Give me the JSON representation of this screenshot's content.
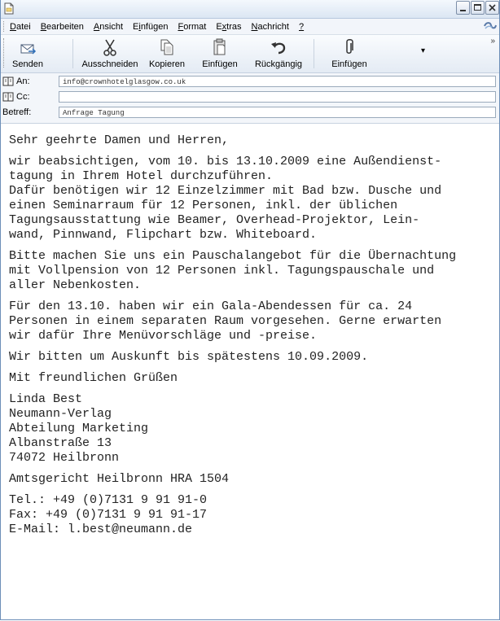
{
  "menu": {
    "items": [
      {
        "pre": "",
        "ul": "D",
        "post": "atei"
      },
      {
        "pre": "",
        "ul": "B",
        "post": "earbeiten"
      },
      {
        "pre": "",
        "ul": "A",
        "post": "nsicht"
      },
      {
        "pre": "E",
        "ul": "i",
        "post": "nfügen"
      },
      {
        "pre": "",
        "ul": "F",
        "post": "ormat"
      },
      {
        "pre": "E",
        "ul": "x",
        "post": "tras"
      },
      {
        "pre": "",
        "ul": "N",
        "post": "achricht"
      },
      {
        "pre": "",
        "ul": "?",
        "post": ""
      }
    ]
  },
  "toolbar": {
    "send": "Senden",
    "cut": "Ausschneiden",
    "copy": "Kopieren",
    "paste": "Einfügen",
    "undo": "Rückgängig",
    "attach": "Einfügen",
    "overflow": "»",
    "more": "▾"
  },
  "headers": {
    "to_label": "An:",
    "to_value": "info@crownhotelglasgow.co.uk",
    "cc_label": "Cc:",
    "cc_value": "",
    "subject_label": "Betreff:",
    "subject_value": "Anfrage Tagung"
  },
  "body": {
    "p1": "Sehr geehrte Damen und Herren,",
    "p2": "wir beabsichtigen, vom 10. bis 13.10.2009 eine Außendienst-\ntagung in Ihrem Hotel durchzuführen.\nDafür benötigen wir 12 Einzelzimmer mit Bad bzw. Dusche und\neinen Seminarraum für 12 Personen, inkl. der üblichen\nTagungsausstattung wie Beamer, Overhead-Projektor, Lein-\nwand, Pinnwand, Flipchart bzw. Whiteboard.",
    "p3": "Bitte machen Sie uns ein Pauschalangebot für die Übernachtung\nmit Vollpension von 12 Personen inkl. Tagungspauschale und\naller Nebenkosten.",
    "p4": "Für den 13.10. haben wir ein Gala-Abendessen für ca. 24\nPersonen in einem separaten Raum vorgesehen. Gerne erwarten\nwir dafür Ihre Menüvorschläge und -preise.",
    "p5": "Wir bitten um Auskunft bis spätestens 10.09.2009.",
    "p6": "Mit freundlichen Grüßen",
    "p7": "Linda Best\nNeumann-Verlag\nAbteilung Marketing\nAlbanstraße 13\n74072 Heilbronn",
    "p8": "Amtsgericht Heilbronn HRA 1504",
    "p9": "Tel.: +49 (0)7131 9 91 91-0\nFax: +49 (0)7131 9 91 91-17\nE-Mail: l.best@neumann.de"
  }
}
